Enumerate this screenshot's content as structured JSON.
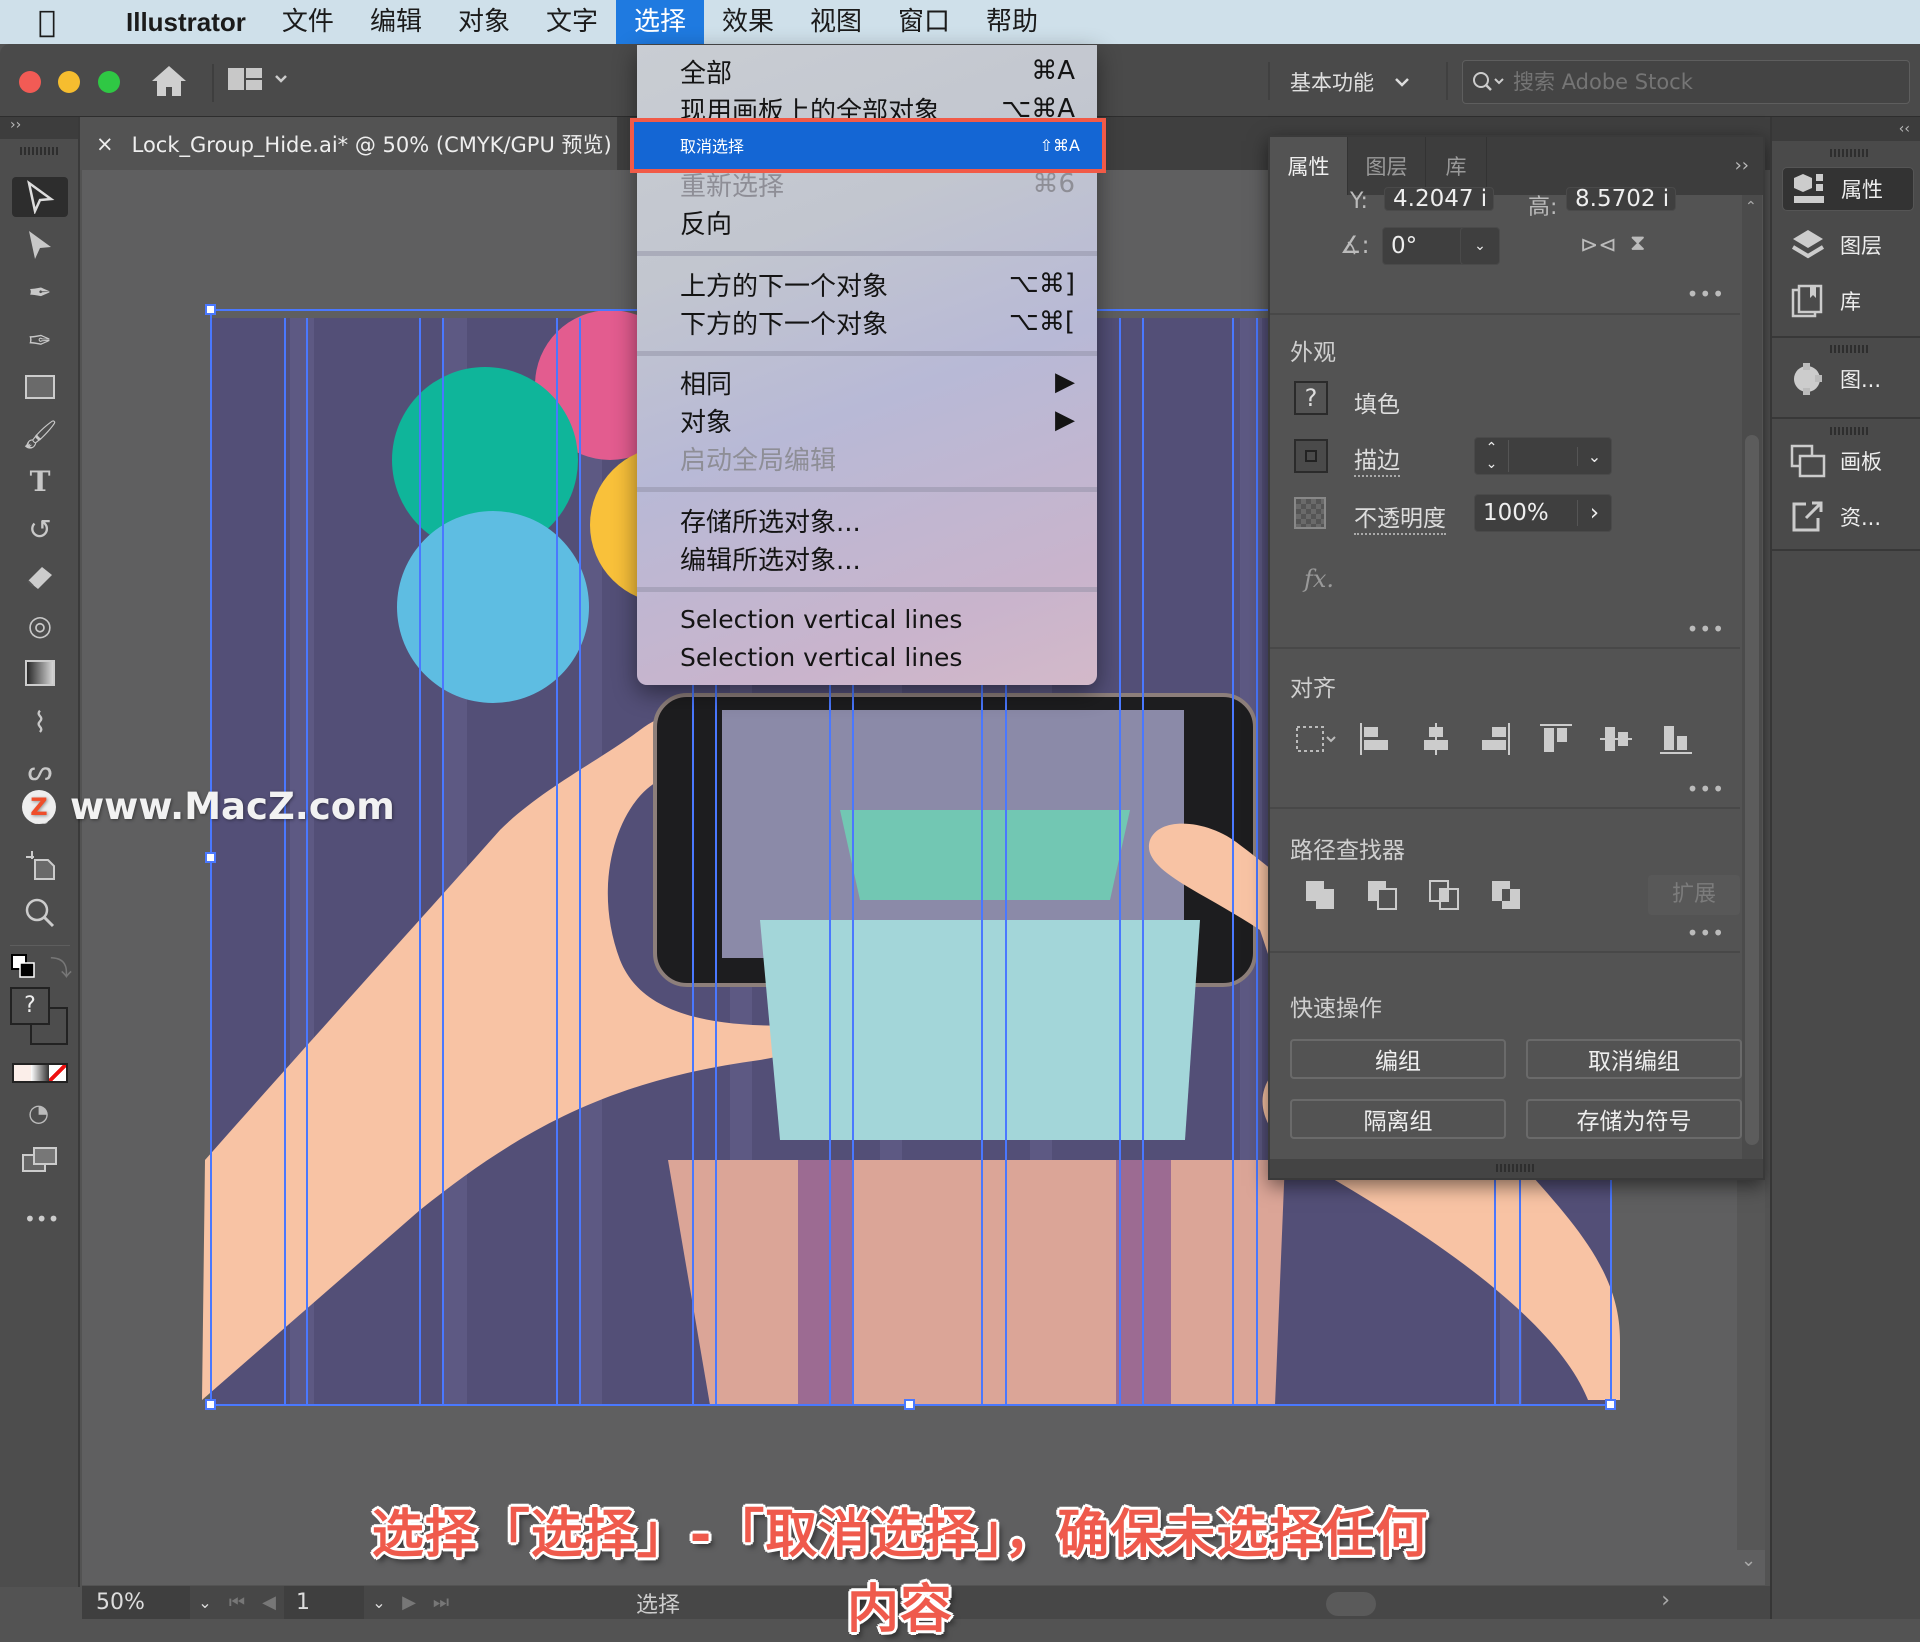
{
  "menubar": {
    "apple_icon": "apple-logo",
    "items": [
      "Illustrator",
      "文件",
      "编辑",
      "对象",
      "文字",
      "选择",
      "效果",
      "视图",
      "窗口",
      "帮助"
    ],
    "active_index": 5
  },
  "app_toolbar": {
    "home_icon": "home-icon",
    "arrange_icon": "arrange-documents-icon",
    "workspace": "基本功能",
    "stock_search_placeholder": "搜索 Adobe Stock"
  },
  "document_tab": {
    "close": "×",
    "title": "Lock_Group_Hide.ai* @ 50% (CMYK/GPU 预览)"
  },
  "select_menu": {
    "items": [
      {
        "label": "全部",
        "shortcut": "⌘A",
        "enabled": true
      },
      {
        "label": "现用画板上的全部对象",
        "shortcut": "⌥⌘A",
        "enabled": true
      },
      {
        "label": "取消选择",
        "shortcut": "⇧⌘A",
        "enabled": true,
        "highlighted": true
      },
      {
        "label": "重新选择",
        "shortcut": "⌘6",
        "enabled": false
      },
      {
        "label": "反向",
        "shortcut": "",
        "enabled": true
      },
      {
        "label": "上方的下一个对象",
        "shortcut": "⌥⌘]",
        "enabled": true
      },
      {
        "label": "下方的下一个对象",
        "shortcut": "⌥⌘[",
        "enabled": true
      },
      {
        "label": "相同",
        "shortcut": "▶",
        "enabled": true
      },
      {
        "label": "对象",
        "shortcut": "▶",
        "enabled": true
      },
      {
        "label": "启动全局编辑",
        "shortcut": "",
        "enabled": false
      },
      {
        "label": "存储所选对象...",
        "shortcut": "",
        "enabled": true
      },
      {
        "label": "编辑所选对象...",
        "shortcut": "",
        "enabled": true
      },
      {
        "label": "Selection vertical lines",
        "shortcut": "",
        "enabled": true
      },
      {
        "label": "Selection vertical lines",
        "shortcut": "",
        "enabled": true
      }
    ]
  },
  "properties_panel": {
    "tabs": [
      "属性",
      "图层",
      "库"
    ],
    "active_tab": 0,
    "transform": {
      "y_label": "Y:",
      "y_value": "4.2047 i",
      "h_label": "高:",
      "h_value": "8.5702 i",
      "angle_value": "0°"
    },
    "appearance": {
      "title": "外观",
      "fill_label": "填色",
      "fill_swatch": "?",
      "stroke_label": "描边",
      "opacity_label": "不透明度",
      "opacity_value": "100%",
      "fx_label": "fx."
    },
    "align": {
      "title": "对齐"
    },
    "pathfinder": {
      "title": "路径查找器",
      "expand_label": "扩展"
    },
    "quick_actions": {
      "title": "快速操作",
      "buttons": [
        "编组",
        "取消编组",
        "隔离组",
        "存储为符号"
      ]
    },
    "more": "•••"
  },
  "right_dock": {
    "collapse": "‹‹",
    "items": [
      {
        "label": "属性",
        "icon": "properties-icon",
        "active": true
      },
      {
        "label": "图层",
        "icon": "layers-icon"
      },
      {
        "label": "库",
        "icon": "libraries-icon"
      },
      {
        "label": "图...",
        "icon": "image-trace-icon"
      },
      {
        "label": "画板",
        "icon": "artboards-icon"
      },
      {
        "label": "资...",
        "icon": "asset-export-icon"
      }
    ]
  },
  "left_toolbar": {
    "expand": "››",
    "tools": [
      "selection-tool",
      "direct-selection-tool",
      "pen-tool",
      "curvature-tool",
      "rectangle-tool",
      "paintbrush-tool",
      "type-tool",
      "rotate-tool",
      "eraser-tool",
      "shape-builder-tool",
      "gradient-tool",
      "eyedropper-tool",
      "puppet-warp-tool",
      "blend-tool",
      "artboard-tool",
      "zoom-tool"
    ],
    "fill_stroke_unknown": "?",
    "more": "•••"
  },
  "status_bar": {
    "zoom": "50%",
    "artboard_number": "1",
    "current_tool": "选择"
  },
  "watermark": {
    "logo": "Z",
    "text": "www.MacZ.com"
  },
  "caption": "选择「选择」-「取消选择」，确保未选择任何内容",
  "colors": {
    "menu_highlight": "#1466d4",
    "callout_border": "#f15a47",
    "artboard_bg": "#534f77",
    "selection_blue": "#4a78ff",
    "caption_red": "#ef5a4c"
  }
}
